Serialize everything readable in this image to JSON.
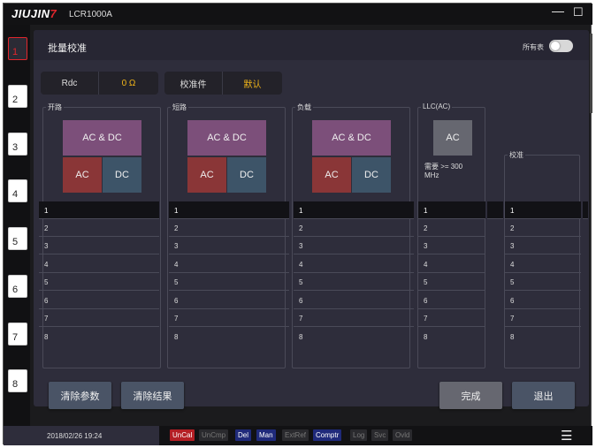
{
  "window": {
    "brand_a": "JIUJIN",
    "brand_b": "7",
    "model": "LCR1000A",
    "min_glyph": "—",
    "max_glyph": "☐"
  },
  "sidebar": {
    "tabs": [
      "1",
      "2",
      "3",
      "4",
      "5",
      "6",
      "7",
      "8"
    ],
    "active": "1"
  },
  "header": {
    "title": "批量校准",
    "all_tables_label": "所有表",
    "toggle_on": false
  },
  "settings": {
    "rdc_label": "Rdc",
    "rdc_value": "0 Ω",
    "std_label": "校准件",
    "std_value": "默认"
  },
  "groups": {
    "open": {
      "label": "开路",
      "acdc": "AC & DC",
      "ac": "AC",
      "dc": "DC"
    },
    "short": {
      "label": "短路",
      "acdc": "AC & DC",
      "ac": "AC",
      "dc": "DC"
    },
    "load": {
      "label": "负载",
      "acdc": "AC & DC",
      "ac": "AC",
      "dc": "DC"
    },
    "llc": {
      "label": "LLC(AC)",
      "ac": "AC",
      "note": "需要 >= 300 MHz"
    },
    "cal": {
      "label": "校准"
    }
  },
  "table": {
    "rows": [
      "1",
      "2",
      "3",
      "4",
      "5",
      "6",
      "7",
      "8"
    ],
    "selected_row": "1"
  },
  "buttons": {
    "clear_params": "清除参数",
    "clear_results": "清除结果",
    "done": "完成",
    "exit": "退出"
  },
  "status": {
    "datetime": "2018/02/26 19:24",
    "indicators": [
      "UnCal",
      "UnCmp",
      "Del",
      "Man",
      "ExtRef",
      "Comptr",
      "Log",
      "Svc",
      "Ovld"
    ],
    "menu_glyph": "☰"
  },
  "colors": {
    "accent_red": "#e0262c",
    "acdc_purple": "#7c4f7a",
    "ac_red": "#8a3637",
    "dc_blue": "#3d5468",
    "gray_btn": "#666770",
    "value_yellow": "#f2b619"
  }
}
